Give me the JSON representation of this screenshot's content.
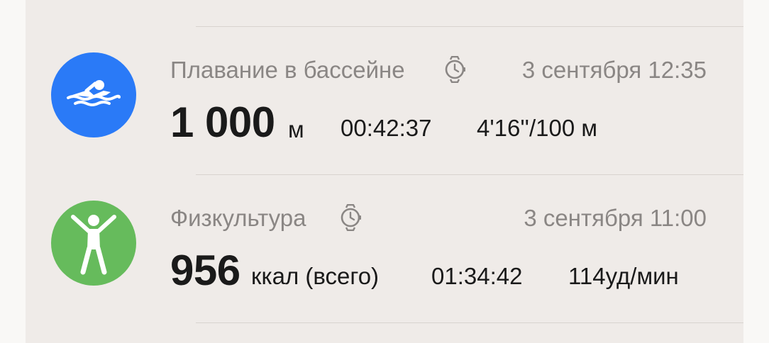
{
  "activities": [
    {
      "title": "Плавание в бассейне",
      "icon": "swim-icon",
      "color": "#2a7af7",
      "date": "3 сентября 12:35",
      "main_value": "1 000",
      "main_unit": "м",
      "duration": "00:42:37",
      "extra": "4'16''/100 м"
    },
    {
      "title": "Физкультура",
      "icon": "workout-icon",
      "color": "#66bb5c",
      "date": "3 сентября 11:00",
      "main_value": "956",
      "main_unit": "ккал (всего)",
      "duration": "01:34:42",
      "extra": "114уд/мин"
    }
  ]
}
